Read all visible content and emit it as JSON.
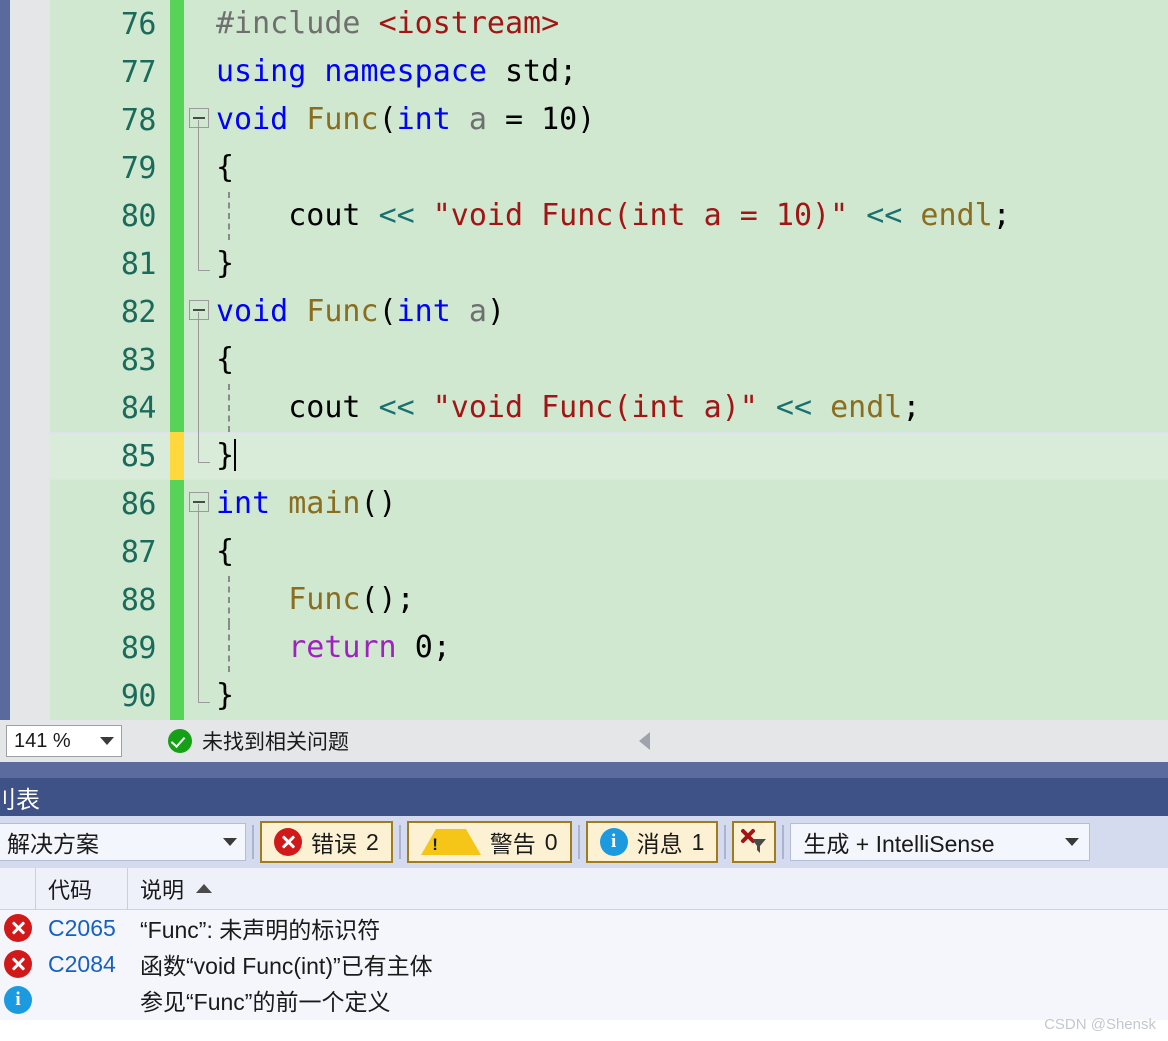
{
  "editor": {
    "zoom_level": "141 %",
    "status_text": "未找到相关问题",
    "status_icon": "check-circle-icon",
    "scroll_left_icon": "scroll-left-arrow-icon",
    "lines": [
      {
        "num": "76",
        "change": "saved",
        "fold": "none",
        "indent_guides": 0,
        "cursor": false,
        "tokens": [
          {
            "t": "#include ",
            "c": "t-pre"
          },
          {
            "t": "<iostream>",
            "c": "t-inc"
          }
        ]
      },
      {
        "num": "77",
        "change": "saved",
        "fold": "none",
        "indent_guides": 0,
        "cursor": false,
        "tokens": [
          {
            "t": "using namespace ",
            "c": "t-kw"
          },
          {
            "t": "std;",
            "c": "t-plain"
          }
        ]
      },
      {
        "num": "78",
        "change": "saved",
        "fold": "box",
        "indent_guides": 0,
        "cursor": false,
        "tokens": [
          {
            "t": "void ",
            "c": "t-kw"
          },
          {
            "t": "Func",
            "c": "t-fn"
          },
          {
            "t": "(",
            "c": "t-plain"
          },
          {
            "t": "int ",
            "c": "t-kw"
          },
          {
            "t": "a",
            "c": "t-var"
          },
          {
            "t": " = 10)",
            "c": "t-plain"
          }
        ]
      },
      {
        "num": "79",
        "change": "saved",
        "fold": "line",
        "indent_guides": 0,
        "cursor": false,
        "tokens": [
          {
            "t": "{",
            "c": "t-plain"
          }
        ]
      },
      {
        "num": "80",
        "change": "saved",
        "fold": "line",
        "indent_guides": 1,
        "cursor": false,
        "tokens": [
          {
            "t": "    cout ",
            "c": "t-plain"
          },
          {
            "t": "<< ",
            "c": "t-op"
          },
          {
            "t": "\"void Func(int a = 10)\"",
            "c": "t-str"
          },
          {
            "t": " << ",
            "c": "t-op"
          },
          {
            "t": "endl",
            "c": "t-fn"
          },
          {
            "t": ";",
            "c": "t-plain"
          }
        ]
      },
      {
        "num": "81",
        "change": "saved",
        "fold": "elbow",
        "indent_guides": 0,
        "cursor": false,
        "tokens": [
          {
            "t": "}",
            "c": "t-plain"
          }
        ]
      },
      {
        "num": "82",
        "change": "saved",
        "fold": "box",
        "indent_guides": 0,
        "cursor": false,
        "tokens": [
          {
            "t": "void ",
            "c": "t-kw"
          },
          {
            "t": "Func",
            "c": "t-fn"
          },
          {
            "t": "(",
            "c": "t-plain"
          },
          {
            "t": "int ",
            "c": "t-kw"
          },
          {
            "t": "a",
            "c": "t-var"
          },
          {
            "t": ")",
            "c": "t-plain"
          }
        ]
      },
      {
        "num": "83",
        "change": "saved",
        "fold": "line",
        "indent_guides": 0,
        "cursor": false,
        "tokens": [
          {
            "t": "{",
            "c": "t-plain"
          }
        ]
      },
      {
        "num": "84",
        "change": "saved",
        "fold": "line",
        "indent_guides": 1,
        "cursor": false,
        "tokens": [
          {
            "t": "    cout ",
            "c": "t-plain"
          },
          {
            "t": "<< ",
            "c": "t-op"
          },
          {
            "t": "\"void Func(int a)\"",
            "c": "t-str"
          },
          {
            "t": " << ",
            "c": "t-op"
          },
          {
            "t": "endl",
            "c": "t-fn"
          },
          {
            "t": ";",
            "c": "t-plain"
          }
        ]
      },
      {
        "num": "85",
        "change": "modified",
        "fold": "elbow",
        "indent_guides": 0,
        "cursor": true,
        "tokens": [
          {
            "t": "}",
            "c": "t-plain"
          }
        ]
      },
      {
        "num": "86",
        "change": "saved",
        "fold": "box",
        "indent_guides": 0,
        "cursor": false,
        "tokens": [
          {
            "t": "int ",
            "c": "t-kw"
          },
          {
            "t": "main",
            "c": "t-fn"
          },
          {
            "t": "()",
            "c": "t-plain"
          }
        ]
      },
      {
        "num": "87",
        "change": "saved",
        "fold": "line",
        "indent_guides": 0,
        "cursor": false,
        "tokens": [
          {
            "t": "{",
            "c": "t-plain"
          }
        ]
      },
      {
        "num": "88",
        "change": "saved",
        "fold": "line",
        "indent_guides": 1,
        "cursor": false,
        "tokens": [
          {
            "t": "    ",
            "c": "t-plain"
          },
          {
            "t": "Func",
            "c": "t-fn"
          },
          {
            "t": "();",
            "c": "t-plain"
          }
        ]
      },
      {
        "num": "89",
        "change": "saved",
        "fold": "line",
        "indent_guides": 1,
        "cursor": false,
        "tokens": [
          {
            "t": "    ",
            "c": "t-plain"
          },
          {
            "t": "return ",
            "c": "t-ctl"
          },
          {
            "t": "0;",
            "c": "t-plain"
          }
        ]
      },
      {
        "num": "90",
        "change": "saved",
        "fold": "elbow",
        "indent_guides": 0,
        "cursor": false,
        "tokens": [
          {
            "t": "}",
            "c": "t-plain"
          }
        ]
      }
    ]
  },
  "panel": {
    "title": "刂表",
    "toolbar": {
      "scope_value": "解决方案",
      "errors_label": "错误",
      "errors_count": "2",
      "warnings_label": "警告",
      "warnings_count": "0",
      "messages_label": "消息",
      "messages_count": "1",
      "clear_filter_icon": "clear-filter-icon",
      "filter_value": "生成 + IntelliSense"
    },
    "table": {
      "columns": {
        "icon": "",
        "code": "代码",
        "description": "说明"
      },
      "sort_column": "说明",
      "sort_direction": "ascending",
      "rows": [
        {
          "severity": "error",
          "code": "C2065",
          "description": "“Func”: 未声明的标识符"
        },
        {
          "severity": "error",
          "code": "C2084",
          "description": "函数“void Func(int)”已有主体"
        },
        {
          "severity": "info",
          "code": "",
          "description": "参见“Func”的前一个定义"
        }
      ]
    }
  },
  "watermark": "CSDN @Shensk",
  "colors": {
    "editor_bg": "#cfe8cf",
    "current_line_bg": "#d9ecd9",
    "line_number": "#1a6b5c",
    "change_saved": "#57d357",
    "change_modified": "#ffd83d",
    "panel_title_bg": "#3f5288",
    "panel_toolbar_bg": "#d4dbee",
    "toggle_bg": "#fdf1d3",
    "toggle_border": "#a07c1c",
    "error_red": "#d21919",
    "warning_yellow": "#f5c518",
    "info_blue": "#1c9ae0",
    "code_link": "#1560c4",
    "keyword_blue": "#0000ff",
    "string_red": "#a31515",
    "function_olive": "#8a6d1f",
    "control_purple": "#a020c0",
    "operator_teal": "#1a7070"
  }
}
